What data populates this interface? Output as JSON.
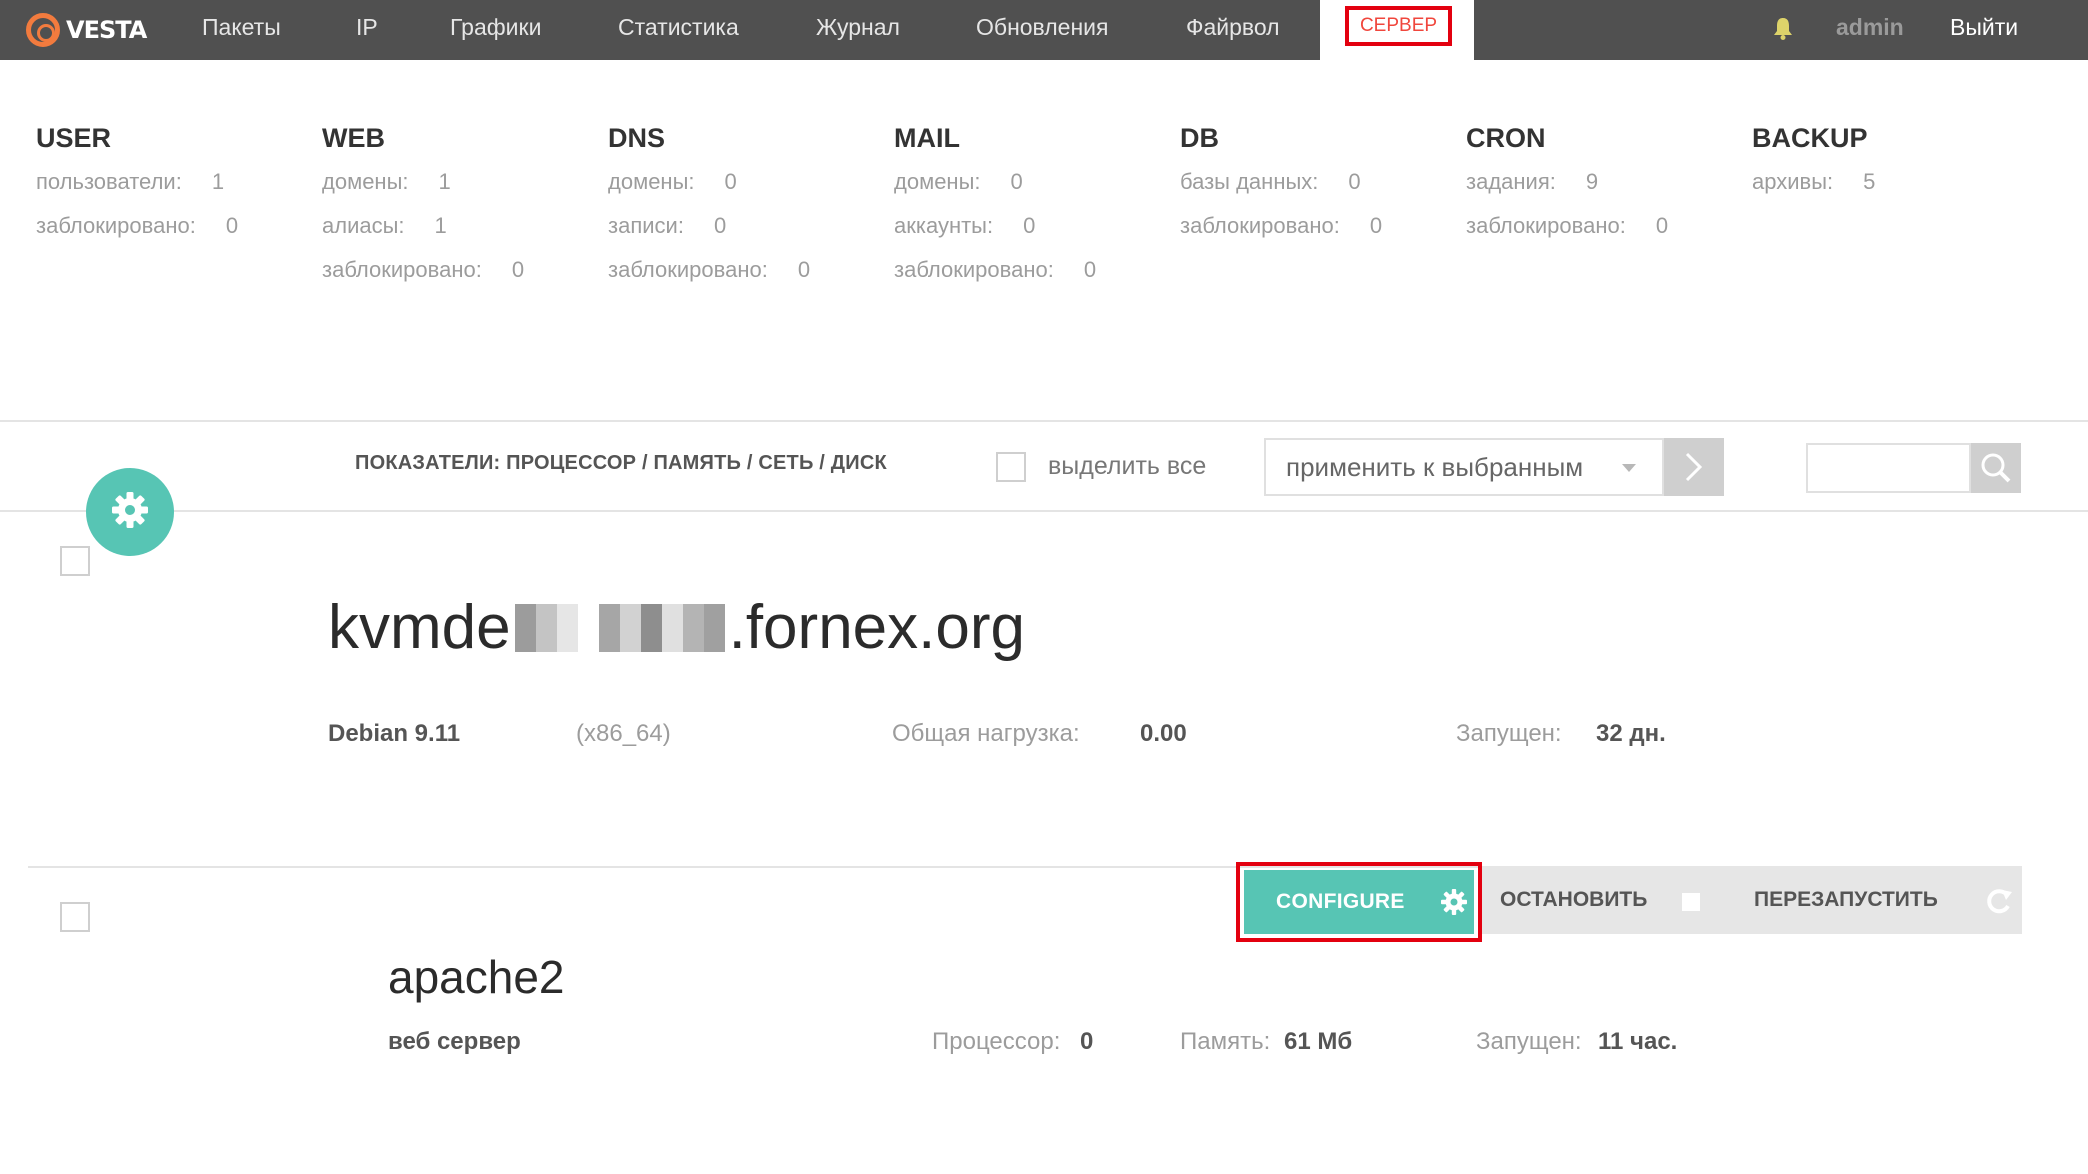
{
  "app": {
    "logo_text": "VESTA"
  },
  "nav": {
    "items": [
      "Пакеты",
      "IP",
      "Графики",
      "Статистика",
      "Журнал",
      "Обновления",
      "Файрвол"
    ],
    "active": "СЕРВЕР",
    "user": "admin",
    "logout": "Выйти"
  },
  "stats": [
    {
      "title": "USER",
      "rows": [
        {
          "label": "пользователи:",
          "value": "1"
        },
        {
          "label": "заблокировано:",
          "value": "0"
        }
      ]
    },
    {
      "title": "WEB",
      "rows": [
        {
          "label": "домены:",
          "value": "1"
        },
        {
          "label": "алиасы:",
          "value": "1"
        },
        {
          "label": "заблокировано:",
          "value": "0"
        }
      ]
    },
    {
      "title": "DNS",
      "rows": [
        {
          "label": "домены:",
          "value": "0"
        },
        {
          "label": "записи:",
          "value": "0"
        },
        {
          "label": "заблокировано:",
          "value": "0"
        }
      ]
    },
    {
      "title": "MAIL",
      "rows": [
        {
          "label": "домены:",
          "value": "0"
        },
        {
          "label": "аккаунты:",
          "value": "0"
        },
        {
          "label": "заблокировано:",
          "value": "0"
        }
      ]
    },
    {
      "title": "DB",
      "rows": [
        {
          "label": "базы данных:",
          "value": "0"
        },
        {
          "label": "заблокировано:",
          "value": "0"
        }
      ]
    },
    {
      "title": "CRON",
      "rows": [
        {
          "label": "задания:",
          "value": "9"
        },
        {
          "label": "заблокировано:",
          "value": "0"
        }
      ]
    },
    {
      "title": "BACKUP",
      "rows": [
        {
          "label": "архивы:",
          "value": "5"
        }
      ]
    }
  ],
  "toolbar": {
    "metrics_label": "ПОКАЗАТЕЛИ: ПРОЦЕССОР / ПАМЯТЬ / СЕТЬ / ДИСК",
    "select_all": "выделить все",
    "apply_select": "применить к выбранным",
    "search_placeholder": ""
  },
  "server": {
    "name_prefix": "kvmde",
    "name_suffix": ".fornex.org",
    "os": "Debian 9.11",
    "arch": "(x86_64)",
    "load_label": "Общая нагрузка:",
    "load_value": "0.00",
    "uptime_label": "Запущен:",
    "uptime_value": "32 дн."
  },
  "service": {
    "name": "apache2",
    "type": "веб сервер",
    "configure": "CONFIGURE",
    "stop": "ОСТАНОВИТЬ",
    "restart": "ПЕРЕЗАПУСТИТЬ",
    "cpu_label": "Процессор:",
    "cpu_value": "0",
    "mem_label": "Память:",
    "mem_value": "61 Мб",
    "uptime_label": "Запущен:",
    "uptime_value": "11 час."
  },
  "colors": {
    "topbar": "#505050",
    "accent": "#57c5b4",
    "highlight": "#e3000f",
    "logo": "#f27b3e"
  }
}
